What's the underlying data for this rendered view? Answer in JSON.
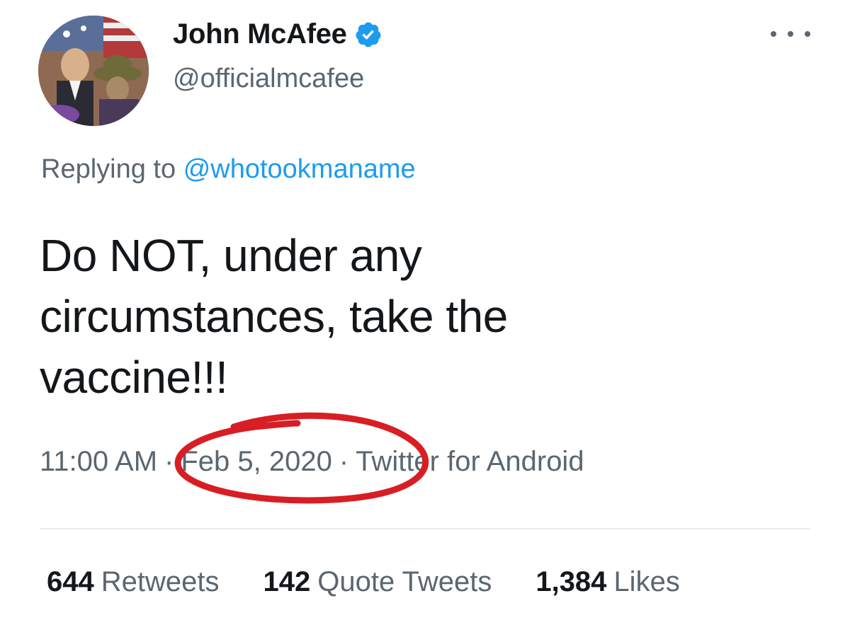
{
  "author": {
    "display_name": "John McAfee",
    "handle": "@officialmcafee",
    "verified": true,
    "avatar": "profile-photo"
  },
  "reply": {
    "prefix": "Replying to",
    "target": "@whotookmaname"
  },
  "tweet": {
    "lines": [
      "Do NOT, under any",
      "circumstances, take the",
      "vaccine!!!"
    ]
  },
  "meta": {
    "time": "11:00 AM",
    "date": "Feb 5, 2020",
    "source": "Twitter for Android",
    "separator": "·"
  },
  "stats": {
    "retweets_count": "644",
    "retweets_label": "Retweets",
    "quote_count": "142",
    "quote_label": "Quote Tweets",
    "likes_count": "1,384",
    "likes_label": "Likes"
  },
  "colors": {
    "link": "#1d9bf0",
    "verified": "#1d9bf0",
    "annotation": "#d81e24"
  },
  "icons": {
    "verified": "verified-badge-icon",
    "more": "more-options-icon"
  }
}
